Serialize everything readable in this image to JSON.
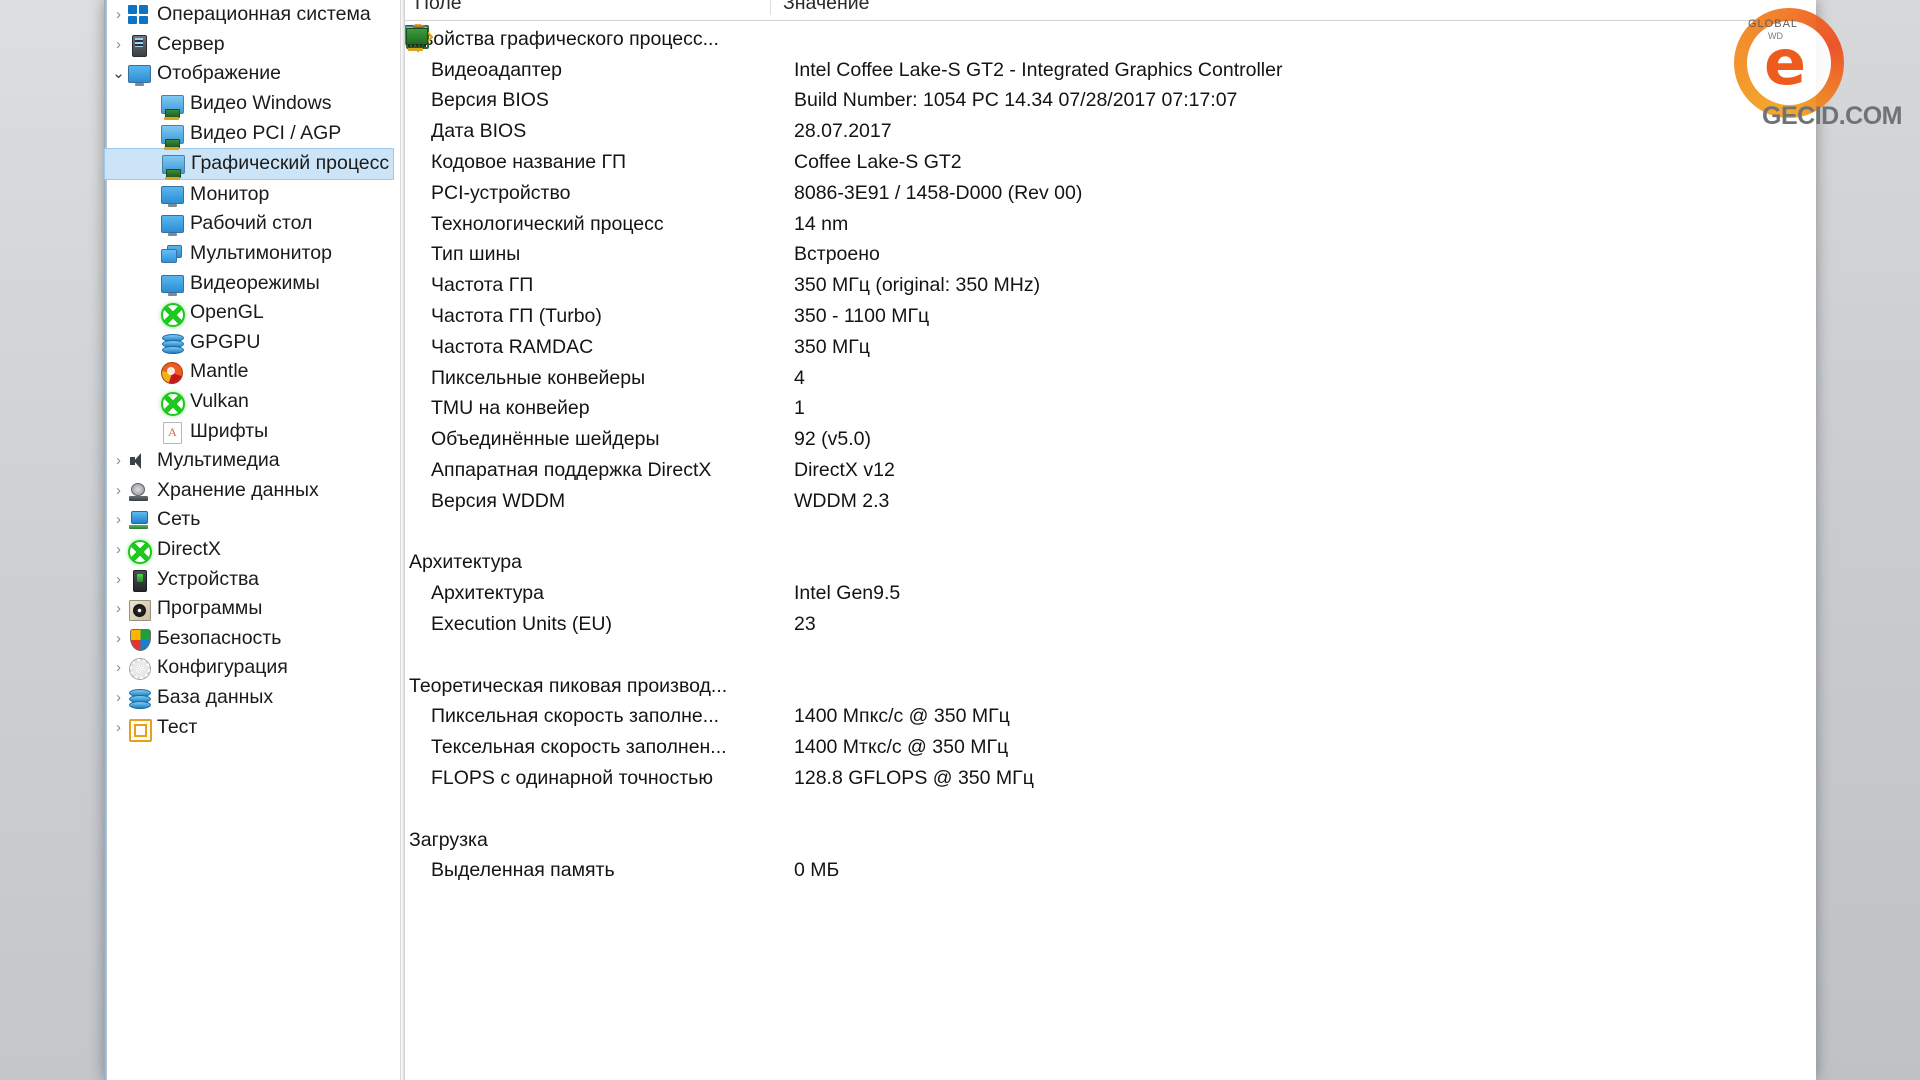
{
  "window": {
    "app": "AIDA64",
    "columns": {
      "field": "Поле",
      "value": "Значение"
    }
  },
  "watermark": {
    "brand": "GECID.COM",
    "badge_top": "GLOBAL",
    "badge_sub": "WD",
    "mark": "e",
    "color": "#ef5a1d"
  },
  "tree": {
    "items": [
      {
        "label": "Операционная система",
        "icon": "windows-icon",
        "chevron": "collapsed",
        "level": 0,
        "selected": false
      },
      {
        "label": "Сервер",
        "icon": "server-icon",
        "chevron": "collapsed",
        "level": 0,
        "selected": false
      },
      {
        "label": "Отображение",
        "icon": "monitor-icon",
        "chevron": "expanded",
        "level": 0,
        "selected": false
      },
      {
        "label": "Видео Windows",
        "icon": "video-card-icon",
        "chevron": "none",
        "level": 1,
        "selected": false
      },
      {
        "label": "Видео PCI / AGP",
        "icon": "video-card-icon",
        "chevron": "none",
        "level": 1,
        "selected": false
      },
      {
        "label": "Графический процесс",
        "icon": "video-card-icon",
        "chevron": "none",
        "level": 1,
        "selected": true
      },
      {
        "label": "Монитор",
        "icon": "monitor-icon",
        "chevron": "none",
        "level": 1,
        "selected": false
      },
      {
        "label": "Рабочий стол",
        "icon": "desktop-icon",
        "chevron": "none",
        "level": 1,
        "selected": false
      },
      {
        "label": "Мультимонитор",
        "icon": "multi-monitor-icon",
        "chevron": "none",
        "level": 1,
        "selected": false
      },
      {
        "label": "Видеорежимы",
        "icon": "monitor-icon",
        "chevron": "none",
        "level": 1,
        "selected": false
      },
      {
        "label": "OpenGL",
        "icon": "xbox-green-icon",
        "chevron": "none",
        "level": 1,
        "selected": false
      },
      {
        "label": "GPGPU",
        "icon": "database-stack-icon",
        "chevron": "none",
        "level": 1,
        "selected": false
      },
      {
        "label": "Mantle",
        "icon": "mantle-icon",
        "chevron": "none",
        "level": 1,
        "selected": false
      },
      {
        "label": "Vulkan",
        "icon": "xbox-green-icon",
        "chevron": "none",
        "level": 1,
        "selected": false
      },
      {
        "label": "Шрифты",
        "icon": "font-page-icon",
        "chevron": "none",
        "level": 1,
        "selected": false
      },
      {
        "label": "Мультимедиа",
        "icon": "speaker-icon",
        "chevron": "collapsed",
        "level": 0,
        "selected": false
      },
      {
        "label": "Хранение данных",
        "icon": "storage-disk-icon",
        "chevron": "collapsed",
        "level": 0,
        "selected": false
      },
      {
        "label": "Сеть",
        "icon": "network-icon",
        "chevron": "collapsed",
        "level": 0,
        "selected": false
      },
      {
        "label": "DirectX",
        "icon": "xbox-green-icon",
        "chevron": "collapsed",
        "level": 0,
        "selected": false
      },
      {
        "label": "Устройства",
        "icon": "device-icon",
        "chevron": "collapsed",
        "level": 0,
        "selected": false
      },
      {
        "label": "Программы",
        "icon": "programs-disc-icon",
        "chevron": "collapsed",
        "level": 0,
        "selected": false
      },
      {
        "label": "Безопасность",
        "icon": "shield-icon",
        "chevron": "collapsed",
        "level": 0,
        "selected": false
      },
      {
        "label": "Конфигурация",
        "icon": "gear-icon",
        "chevron": "collapsed",
        "level": 0,
        "selected": false
      },
      {
        "label": "База данных",
        "icon": "database-stack-icon",
        "chevron": "collapsed",
        "level": 0,
        "selected": false
      },
      {
        "label": "Тест",
        "icon": "test-square-icon",
        "chevron": "collapsed",
        "level": 0,
        "selected": false
      }
    ]
  },
  "details": {
    "sections": [
      {
        "title": "Свойства графического процесс...",
        "icon": "video-card-icon",
        "rows": [
          {
            "field": "Видеоадаптер",
            "value": "Intel Coffee Lake-S GT2 - Integrated Graphics Controller",
            "icon": "video-card-icon"
          },
          {
            "field": "Версия BIOS",
            "value": "Build Number: 1054 PC 14.34  07/28/2017  07:17:07",
            "icon": "bios-chip-icon"
          },
          {
            "field": "Дата BIOS",
            "value": "28.07.2017",
            "icon": "bios-chip-icon"
          },
          {
            "field": "Кодовое название ГП",
            "value": "Coffee Lake-S GT2",
            "icon": "video-card-icon"
          },
          {
            "field": "PCI-устройство",
            "value": "8086-3E91 / 1458-D000  (Rev 00)",
            "icon": "device-icon"
          },
          {
            "field": "Технологический процесс",
            "value": "14 nm",
            "icon": "video-card-icon"
          },
          {
            "field": "Тип шины",
            "value": "Встроено",
            "icon": "video-card-icon"
          },
          {
            "field": "Частота ГП",
            "value": "350 МГц  (original: 350 MHz)",
            "icon": "video-card-icon"
          },
          {
            "field": "Частота ГП (Turbo)",
            "value": "350 - 1100 МГц",
            "icon": "video-card-icon"
          },
          {
            "field": "Частота RAMDAC",
            "value": "350 МГц",
            "icon": "bios-chip-icon"
          },
          {
            "field": "Пиксельные конвейеры",
            "value": "4",
            "icon": "video-card-icon"
          },
          {
            "field": "TMU на конвейер",
            "value": "1",
            "icon": "video-card-icon"
          },
          {
            "field": "Объединённые шейдеры",
            "value": "92  (v5.0)",
            "icon": "video-card-icon"
          },
          {
            "field": "Аппаратная поддержка DirectX",
            "value": "DirectX v12",
            "icon": "xbox-green-icon"
          },
          {
            "field": "Версия WDDM",
            "value": "WDDM 2.3",
            "icon": "windows-icon"
          }
        ]
      },
      {
        "title": "Архитектура",
        "icon": "video-card-icon",
        "rows": [
          {
            "field": "Архитектура",
            "value": "Intel Gen9.5",
            "icon": "video-card-icon"
          },
          {
            "field": "Execution Units (EU)",
            "value": "23",
            "icon": "execution-unit-icon"
          }
        ]
      },
      {
        "title": "Теоретическая пиковая производ...",
        "icon": "diamond-icon",
        "rows": [
          {
            "field": "Пиксельная скорость заполне...",
            "value": "1400 Мпкс/с @ 350 МГц",
            "icon": "video-card-icon"
          },
          {
            "field": "Тексельная скорость заполнен...",
            "value": "1400 Мткс/с @ 350 МГц",
            "icon": "video-card-icon"
          },
          {
            "field": "FLOPS с одинарной точностью",
            "value": "128.8 GFLOPS @ 350 МГц",
            "icon": "video-card-icon"
          }
        ]
      },
      {
        "title": "Загрузка",
        "icon": "hourglass-icon",
        "rows": [
          {
            "field": "Выделенная память",
            "value": "0 МБ",
            "icon": "memory-icon"
          }
        ]
      }
    ]
  }
}
